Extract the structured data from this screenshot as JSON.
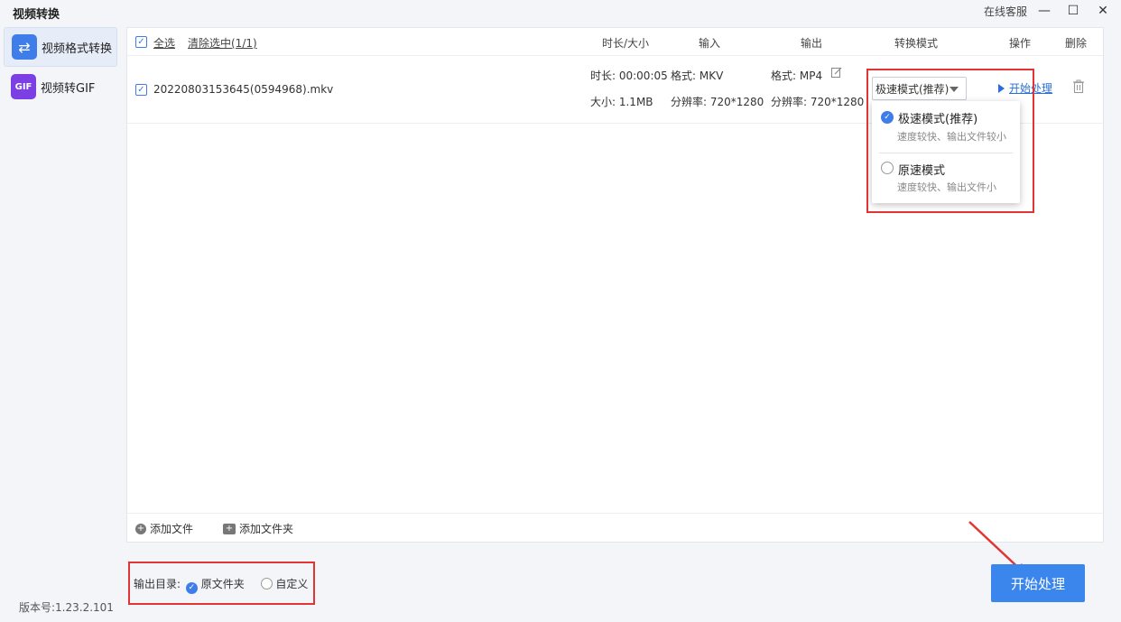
{
  "window": {
    "title": "视频转换",
    "online_service": "在线客服",
    "controls": [
      "—",
      "☐",
      "✕"
    ]
  },
  "sidebar": {
    "items": [
      {
        "label": "视频格式转换",
        "icon": "swap-icon",
        "active": true
      },
      {
        "label": "视频转GIF",
        "icon": "gif-icon",
        "active": false
      }
    ],
    "version": "版本号:1.23.2.101"
  },
  "list_header": {
    "select_all": "全选",
    "clear_selected": "清除选中(1/1)",
    "columns": {
      "duration_size": "时长/大小",
      "input": "输入",
      "output": "输出",
      "mode": "转换模式",
      "action": "操作",
      "delete": "删除"
    }
  },
  "files": [
    {
      "checked": true,
      "name": "20220803153645(0594968).mkv",
      "duration": "时长: 00:00:05",
      "size": "大小: 1.1MB",
      "input_format": "格式: MKV",
      "input_resolution": "分辨率: 720*1280",
      "output_format": "格式: MP4",
      "output_resolution": "分辨率: 720*1280",
      "mode": "极速模式(推荐)",
      "action": "开始处理"
    }
  ],
  "mode_dropdown": {
    "options": [
      {
        "title": "极速模式(推荐)",
        "desc": "速度较快、输出文件较小",
        "selected": true
      },
      {
        "title": "原速模式",
        "desc": "速度较快、输出文件小",
        "selected": false
      }
    ]
  },
  "add_bar": {
    "add_file": "添加文件",
    "add_folder": "添加文件夹"
  },
  "output_dir": {
    "label": "输出目录:",
    "original": "原文件夹",
    "custom": "自定义",
    "selected": "original"
  },
  "start_button": "开始处理",
  "colors": {
    "accent": "#3a86ec",
    "highlight": "#e23434",
    "link": "#2a6fd8"
  }
}
